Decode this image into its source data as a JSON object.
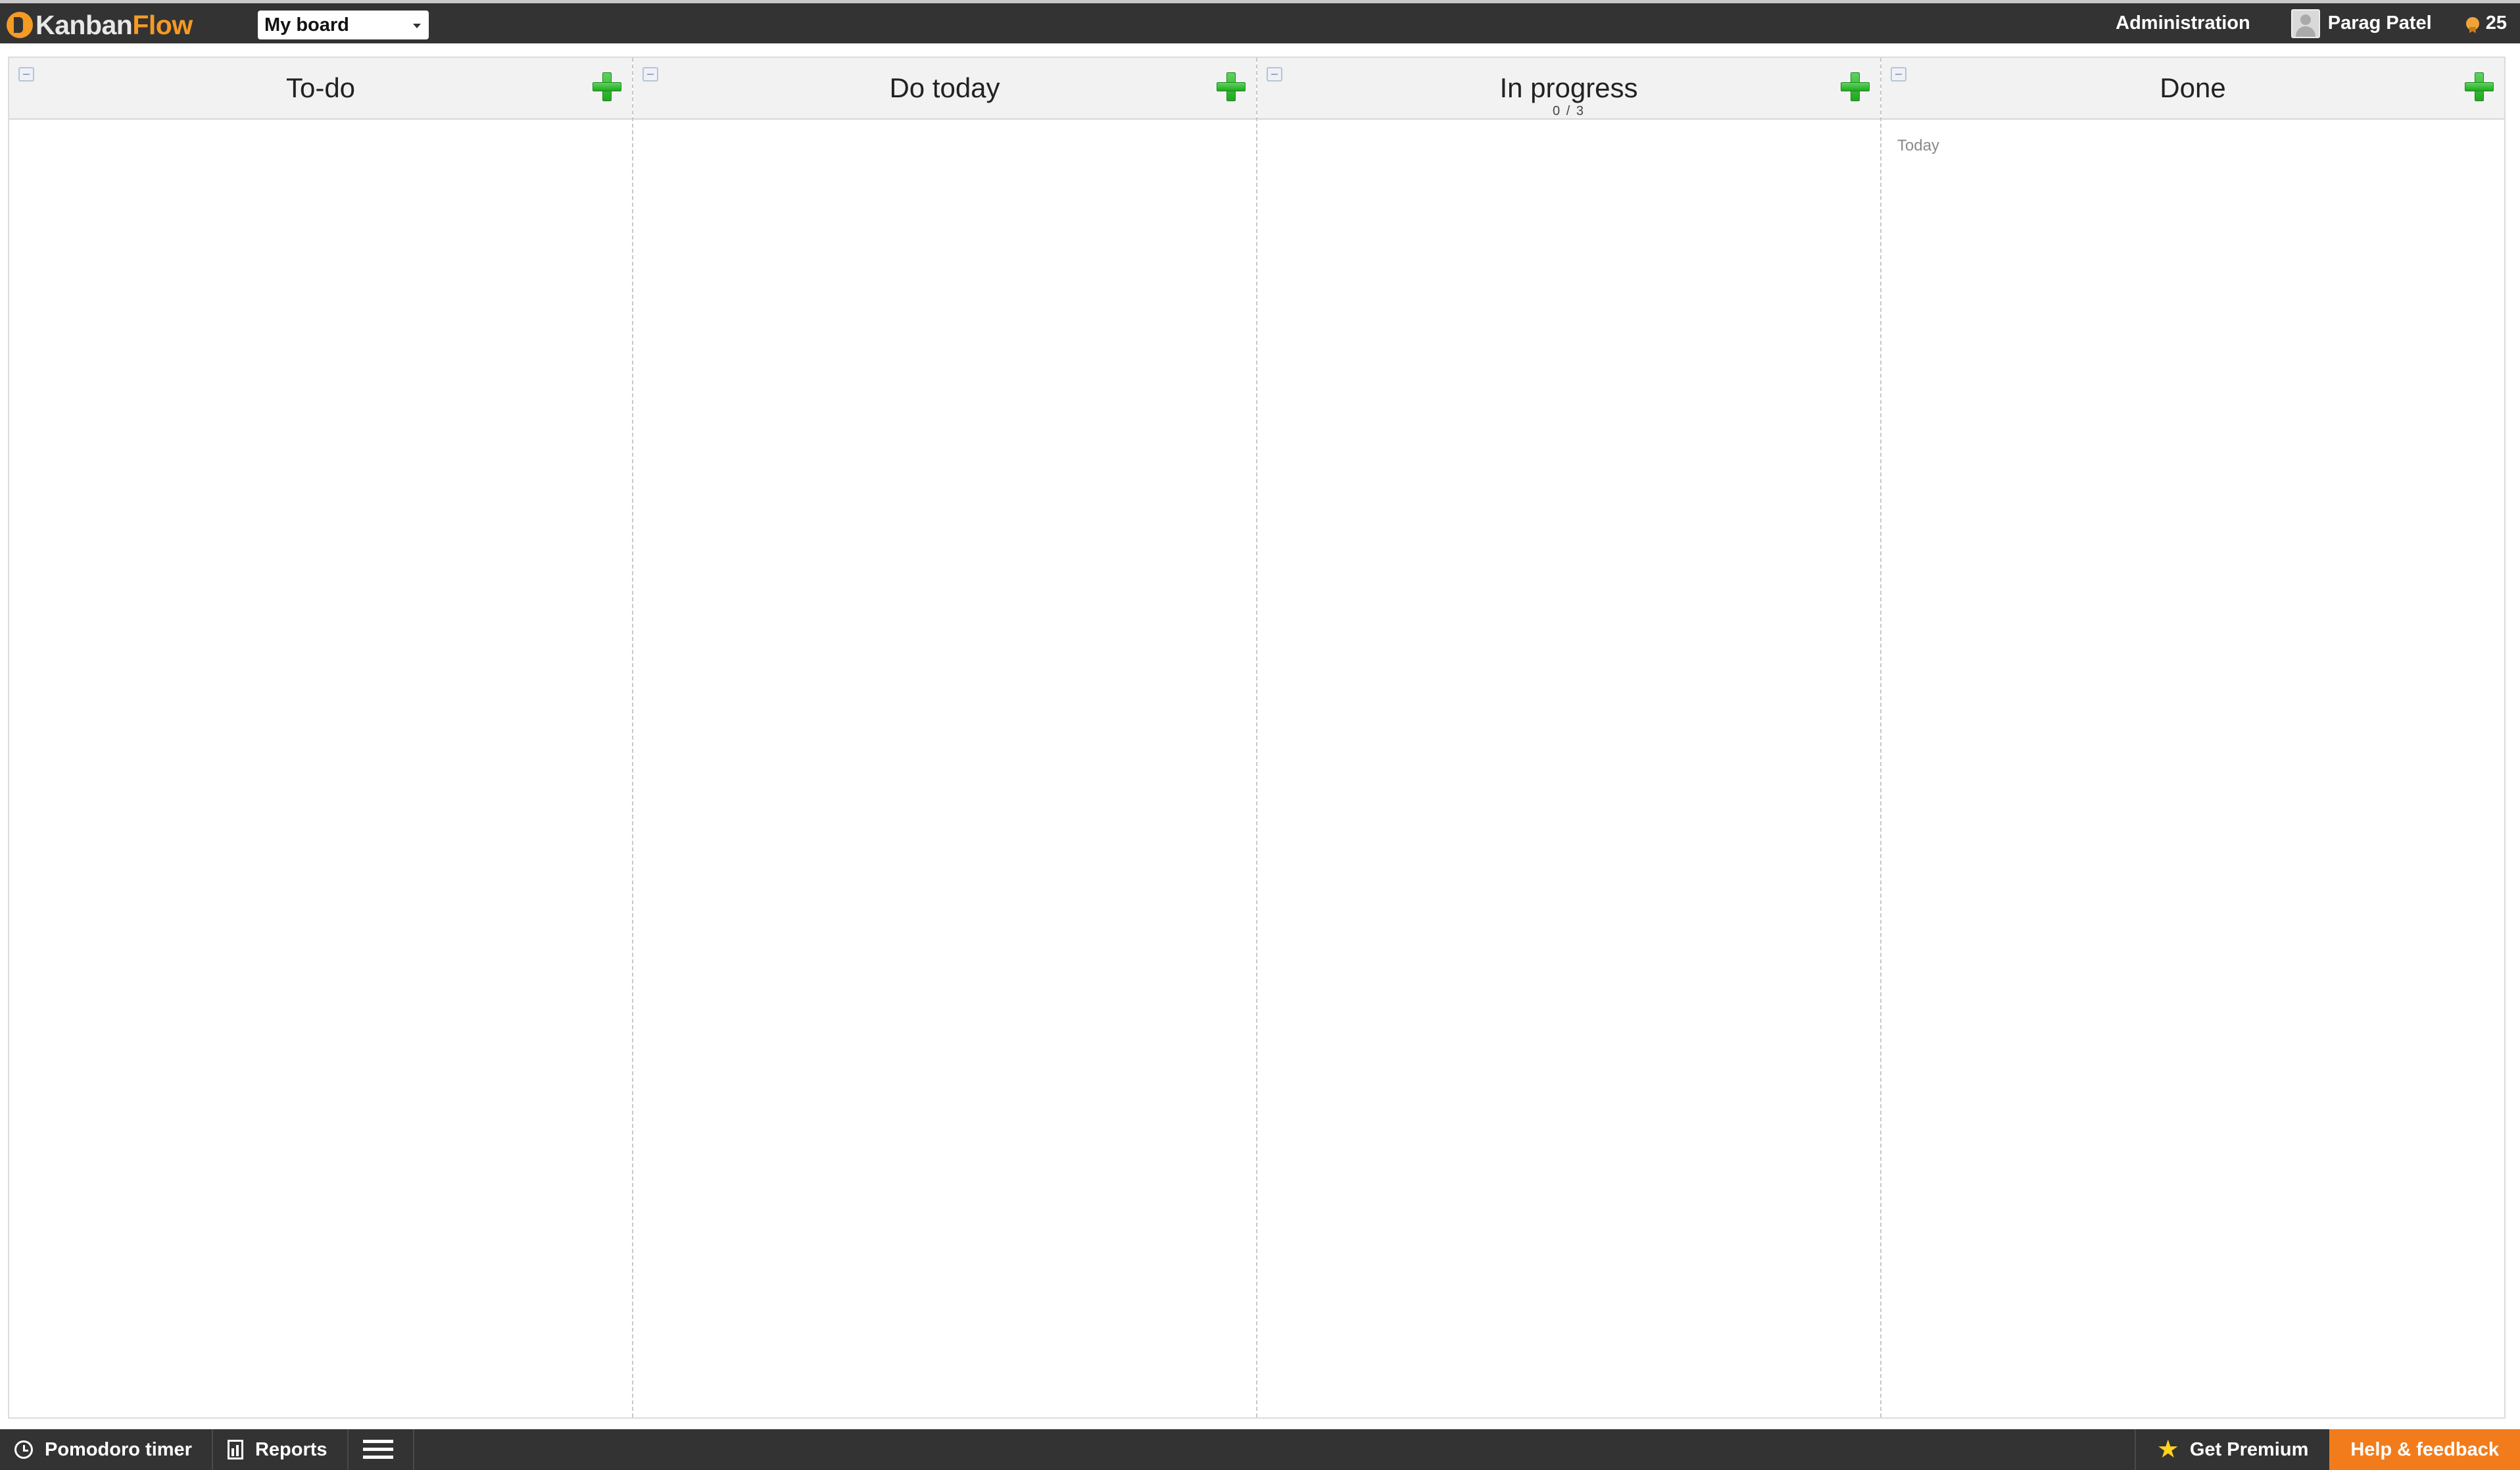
{
  "header": {
    "logo": {
      "part1": "Kanban",
      "part2": "Flow"
    },
    "board_select": {
      "value": "My board"
    },
    "admin_label": "Administration",
    "user_name": "Parag Patel",
    "points": "25"
  },
  "columns": [
    {
      "title": "To-do",
      "wip": "",
      "date_label": ""
    },
    {
      "title": "Do today",
      "wip": "",
      "date_label": ""
    },
    {
      "title": "In progress",
      "wip": "0 / 3",
      "date_label": ""
    },
    {
      "title": "Done",
      "wip": "",
      "date_label": "Today"
    }
  ],
  "footer": {
    "pomodoro_label": "Pomodoro timer",
    "reports_label": "Reports",
    "premium_label": "Get Premium",
    "help_label": "Help & feedback"
  },
  "colors": {
    "topbar": "#333333",
    "accent_orange": "#f27c1b",
    "add_green": "#22a722",
    "star_yellow": "#ffd21f"
  },
  "icons": {
    "logo": "kanbanflow-logo-icon",
    "board_caret": "chevron-down-icon",
    "avatar": "user-avatar-icon",
    "points": "award-badge-icon",
    "collapse": "collapse-column-icon",
    "add": "plus-icon",
    "pomodoro": "clock-icon",
    "reports": "report-icon",
    "menu": "hamburger-menu-icon",
    "premium": "star-icon"
  }
}
